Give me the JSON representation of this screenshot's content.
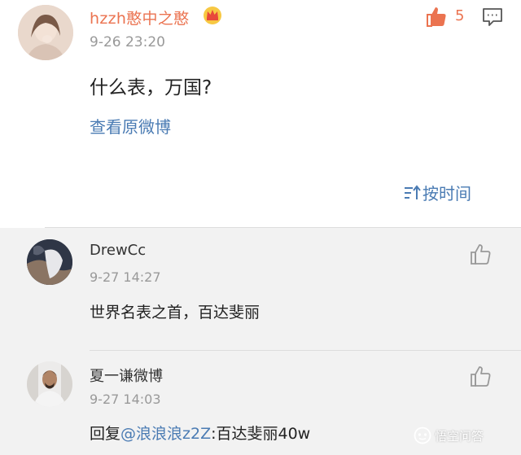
{
  "post": {
    "username": "hzzh憨中之憨",
    "time": "9-26 23:20",
    "content": "什么表，万国?",
    "view_original": "查看原微博",
    "like_count": "5",
    "sort_label": "按时间"
  },
  "comments": [
    {
      "username": "DrewCc",
      "time": "9-27 14:27",
      "text": "世界名表之首，百达斐丽"
    },
    {
      "username": "夏一谦微博",
      "time": "9-27 14:03",
      "reply_prefix": "回复",
      "mention": "@浪浪浪z2Z",
      "reply_text": ":百达斐丽40w"
    }
  ],
  "watermark": {
    "text": "悟空问答"
  },
  "colors": {
    "username": "#eb7350",
    "link": "#4a7bb3",
    "comments_bg": "#f2f2f2"
  }
}
